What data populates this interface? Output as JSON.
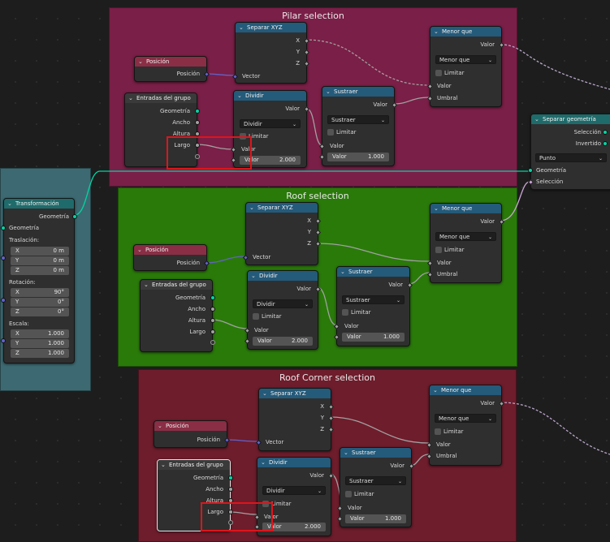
{
  "frames": {
    "pilar": "Pilar selection",
    "roof": "Roof selection",
    "corner": "Roof Corner selection"
  },
  "colors": {
    "frame_pilar": "#7a1f47",
    "frame_roof": "#2a7a0a",
    "frame_corner": "#6e1d2c",
    "frame_transform": "#3d6a72",
    "geometry_socket": "#00d6a3",
    "vector_socket": "#6363c7",
    "value_socket": "#a1a1a1",
    "bool_socket": "#cca6d6",
    "highlight": "#e0141b"
  },
  "labels": {
    "separar_xyz": "Separar XYZ",
    "x": "X",
    "y": "Y",
    "z": "Z",
    "vector": "Vector",
    "posicion": "Posición",
    "menor_que": "Menor que",
    "valor": "Valor",
    "limitar": "Limitar",
    "umbral": "Umbral",
    "dividir": "Dividir",
    "sustraer": "Sustraer",
    "entradas": "Entradas del grupo",
    "geometria": "Geometría",
    "ancho": "Ancho",
    "altura": "Altura",
    "largo": "Largo",
    "two": "2.000",
    "one": "1.000",
    "separar_geo": "Separar geometría",
    "seleccion": "Selección",
    "invertido": "Invertido",
    "punto": "Punto",
    "transformacion": "Transformación",
    "traslacion": "Traslación:",
    "rotacion": "Rotación:",
    "escala": "Escala:",
    "tx": "0 m",
    "ty": "0 m",
    "tz": "0 m",
    "rx": "90°",
    "ry": "0°",
    "rz": "0°",
    "sx": "1.000",
    "sy": "1.000",
    "sz": "1.000"
  },
  "icons": [
    "chevron-down-icon",
    "checkbox-icon",
    "dropdown-arrow-icon"
  ]
}
